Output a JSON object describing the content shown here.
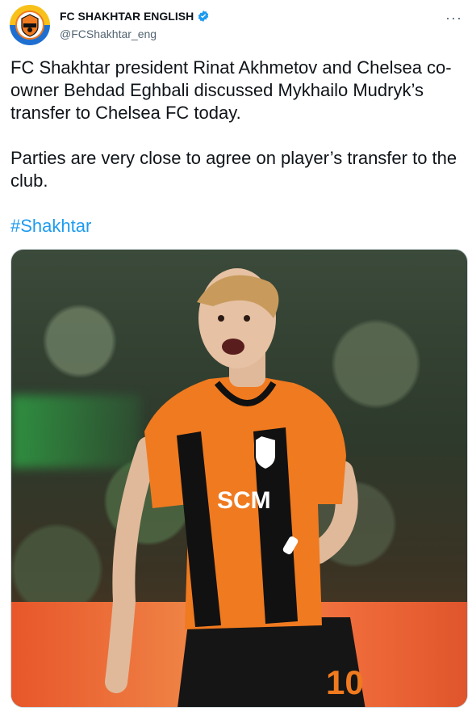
{
  "tweet": {
    "display_name": "FC SHAKHTAR ENGLISH",
    "handle": "@FCShakhtar_eng",
    "more_label": "···",
    "text": "FC Shakhtar president Rinat Akhmetov and Chelsea co-owner Behdad Eghbali discussed Mykhailo Mudryk’s transfer to Chelsea FC today.\n\nParties are very close to agree on player’s transfer to the club.",
    "hashtag": "#Shakhtar"
  },
  "media": {
    "sponsor_text": "SCM",
    "shirt_number": "10"
  },
  "colors": {
    "accent": "#1d9bf0",
    "shirt_orange": "#f07a1f",
    "shirt_black": "#111111"
  },
  "icons": {
    "verified": "verified-badge-icon",
    "avatar": "club-crest-icon",
    "more": "more-options-icon"
  }
}
